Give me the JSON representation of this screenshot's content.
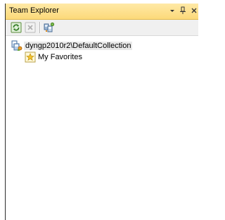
{
  "window": {
    "title": "Team Explorer",
    "controls": {
      "dropdown_glyph": "▾",
      "pin_glyph": "ᵖ",
      "close_glyph": "×"
    }
  },
  "toolbar": {
    "buttons": [
      {
        "name": "refresh",
        "icon": "refresh-icon"
      },
      {
        "name": "stop",
        "icon": "stop-icon"
      },
      {
        "name": "connect",
        "icon": "connect-to-team-project-icon"
      }
    ]
  },
  "tree": {
    "root": {
      "label": "dyngp2010r2\\DefaultCollection",
      "icon": "team-collection-icon"
    },
    "children": [
      {
        "label": "My Favorites",
        "icon": "favorites-star-icon"
      }
    ]
  },
  "colors": {
    "title_bar": "#fcd97a",
    "toolbar": "#f0f0f0",
    "selected_row": "#e9e9e9"
  }
}
